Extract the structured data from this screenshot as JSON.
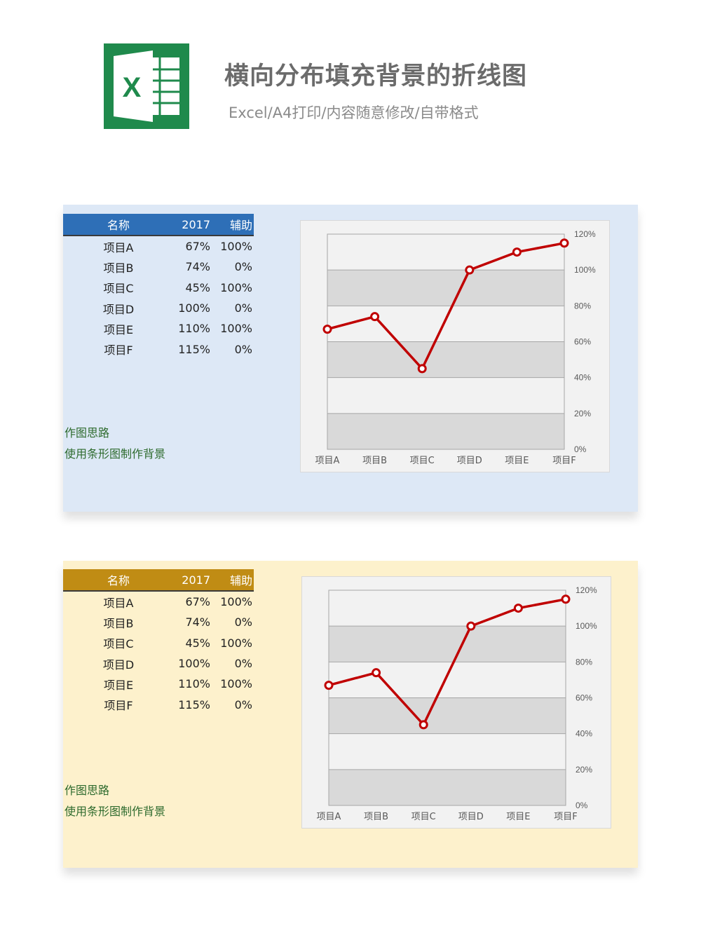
{
  "header": {
    "title": "横向分布填充背景的折线图",
    "subtitle": "Excel/A4打印/内容随意修改/自带格式",
    "logo_icon": "excel-logo-icon",
    "logo_letter": "X",
    "logo_color": "#1f8a4c"
  },
  "colors": {
    "panel1_bg": "#dde8f6",
    "panel1_header": "#2e6fb7",
    "panel2_bg": "#fdf1cc",
    "panel2_header": "#c08c14",
    "line": "#c00000",
    "band_dark": "#d9d9d9",
    "band_light": "#f2f2f2",
    "note_text": "#2e6b2e"
  },
  "table": {
    "headers": [
      "名称",
      "2017",
      "辅助"
    ],
    "rows": [
      [
        "项目A",
        "67%",
        "100%"
      ],
      [
        "项目B",
        "74%",
        "0%"
      ],
      [
        "项目C",
        "45%",
        "100%"
      ],
      [
        "项目D",
        "100%",
        "0%"
      ],
      [
        "项目E",
        "110%",
        "100%"
      ],
      [
        "项目F",
        "115%",
        "0%"
      ]
    ]
  },
  "notes": [
    "作图思路",
    "使用条形图制作背景"
  ],
  "chart_data": [
    {
      "type": "line",
      "categories": [
        "项目A",
        "项目B",
        "项目C",
        "项目D",
        "项目E",
        "项目F"
      ],
      "series": [
        {
          "values": [
            0.67,
            0.74,
            0.45,
            1.0,
            1.1,
            1.15
          ]
        }
      ],
      "background_bands": [
        1,
        0,
        1,
        0,
        1,
        0
      ],
      "ylim": [
        0,
        1.2
      ],
      "yticks": [
        "0%",
        "20%",
        "40%",
        "60%",
        "80%",
        "100%",
        "120%"
      ],
      "y_axis_side": "right",
      "grid": true
    },
    {
      "type": "line",
      "categories": [
        "项目A",
        "项目B",
        "项目C",
        "项目D",
        "项目E",
        "项目F"
      ],
      "series": [
        {
          "values": [
            0.67,
            0.74,
            0.45,
            1.0,
            1.1,
            1.15
          ]
        }
      ],
      "background_bands": [
        1,
        0,
        1,
        0,
        1,
        0
      ],
      "ylim": [
        0,
        1.2
      ],
      "yticks": [
        "0%",
        "20%",
        "40%",
        "60%",
        "80%",
        "100%",
        "120%"
      ],
      "y_axis_side": "right",
      "grid": true
    }
  ]
}
